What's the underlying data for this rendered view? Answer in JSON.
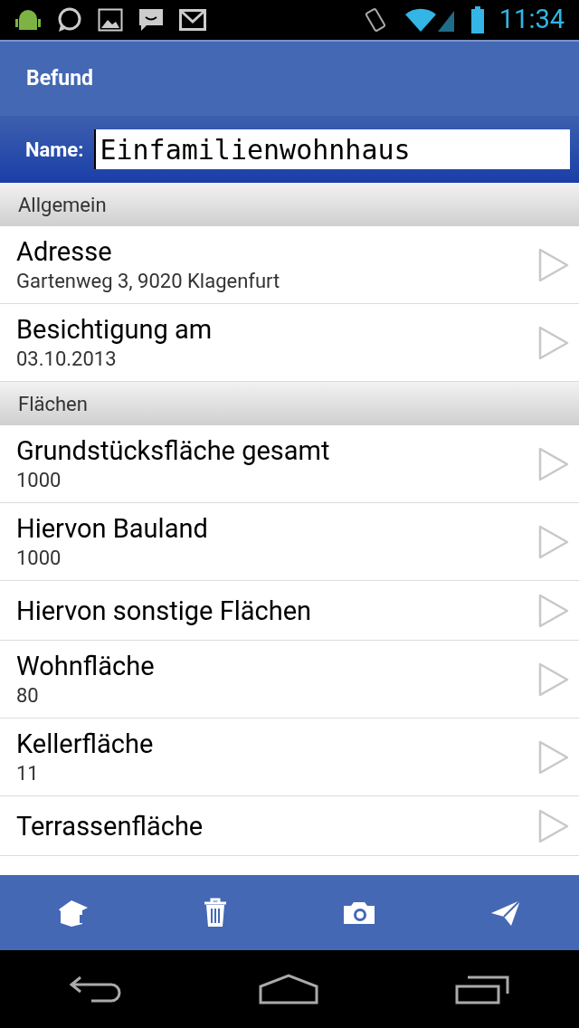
{
  "status_bar": {
    "time": "11:34"
  },
  "title": "Befund",
  "name_field": {
    "label": "Name:",
    "value": "Einfamilienwohnhaus"
  },
  "sections": [
    {
      "header": "Allgemein",
      "rows": [
        {
          "title": "Adresse",
          "value": "Gartenweg 3, 9020 Klagenfurt"
        },
        {
          "title": "Besichtigung am",
          "value": "03.10.2013"
        }
      ]
    },
    {
      "header": "Flächen",
      "rows": [
        {
          "title": "Grundstücksfläche gesamt",
          "value": "1000"
        },
        {
          "title": "Hiervon Bauland",
          "value": "1000"
        },
        {
          "title": "Hiervon sonstige Flächen"
        },
        {
          "title": "Wohnfläche",
          "value": "80"
        },
        {
          "title": "Kellerfläche",
          "value": "11"
        },
        {
          "title": "Terrassenfläche"
        }
      ]
    }
  ]
}
